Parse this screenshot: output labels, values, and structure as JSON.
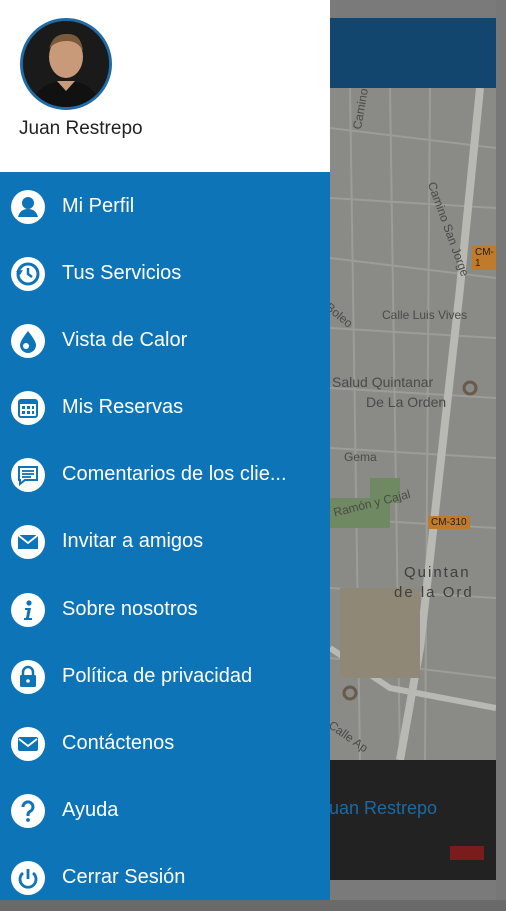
{
  "user": {
    "name": "Juan Restrepo"
  },
  "menu": [
    {
      "label": "Mi Perfil",
      "icon": "person-icon"
    },
    {
      "label": "Tus Servicios",
      "icon": "history-icon"
    },
    {
      "label": "Vista de Calor",
      "icon": "drop-icon"
    },
    {
      "label": "Mis Reservas",
      "icon": "calendar-icon"
    },
    {
      "label": "Comentarios de los clie...",
      "icon": "chat-icon"
    },
    {
      "label": "Invitar a amigos",
      "icon": "mail-icon"
    },
    {
      "label": "Sobre nosotros",
      "icon": "info-icon"
    },
    {
      "label": "Política de privacidad",
      "icon": "lock-icon"
    },
    {
      "label": "Contáctenos",
      "icon": "envelope-icon"
    },
    {
      "label": "Ayuda",
      "icon": "help-icon"
    },
    {
      "label": "Cerrar Sesión",
      "icon": "power-icon"
    }
  ],
  "background": {
    "footer_name": "Juan Restrepo",
    "map_labels": {
      "camino_verdugueto": "Camino Verdugueto",
      "camino_san_jorge": "Camino San Jorge",
      "calle_luis_vives": "Calle Luis Vives",
      "boleo": "Boleo",
      "salud": "Salud Quintanar",
      "de_la_orden": "De La Orden",
      "gema": "Gema",
      "ramon_cajal": "Ramón y Cajal",
      "quintan": "Quintan",
      "de_la_ord": "de la Ord",
      "calle_ap": "Calle Ap"
    },
    "road_badges": {
      "cm1": "CM-1",
      "cm310": "CM-310"
    }
  },
  "colors": {
    "drawer": "#0e74b8",
    "header": "#12466e",
    "white": "#ffffff"
  }
}
